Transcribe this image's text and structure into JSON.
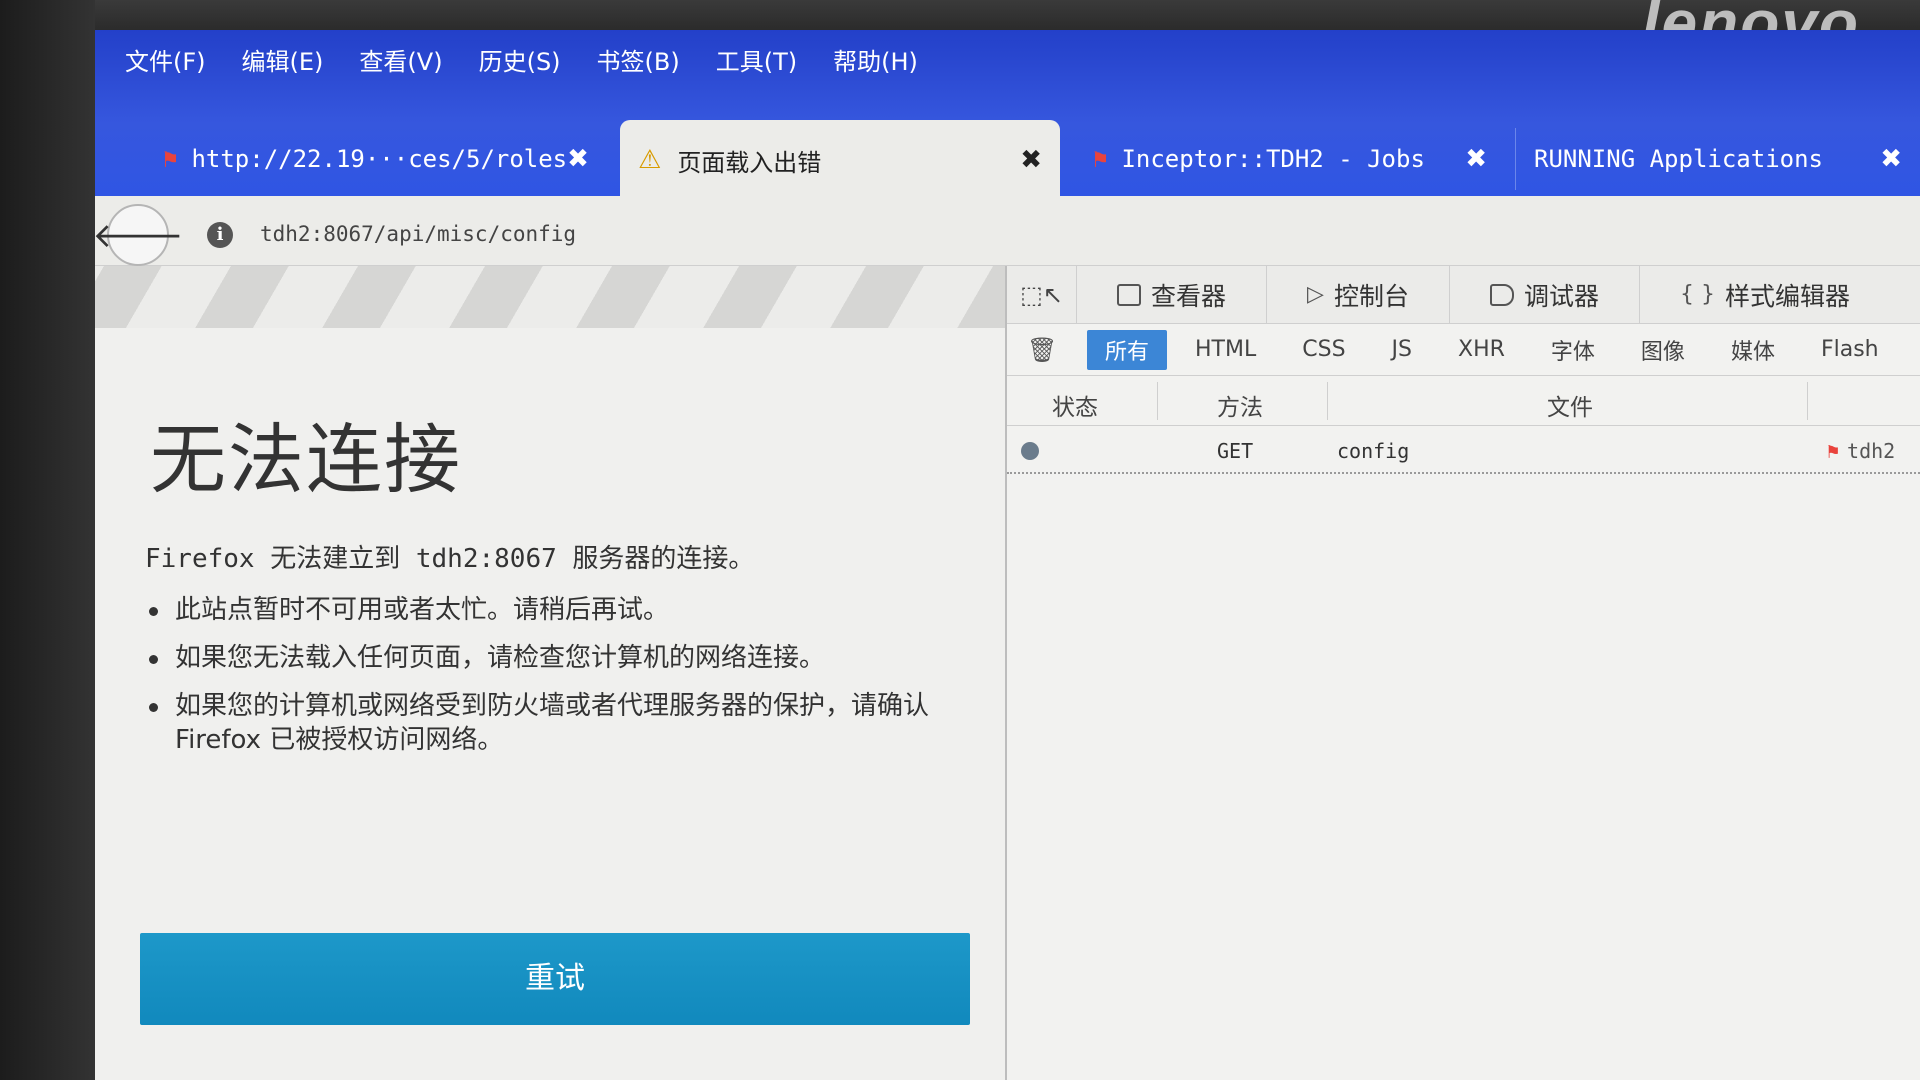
{
  "brand": "lenovo",
  "menubar": [
    "文件(F)",
    "编辑(E)",
    "查看(V)",
    "历史(S)",
    "书签(B)",
    "工具(T)",
    "帮助(H)"
  ],
  "tabs": [
    {
      "title": "http://22.19···ces/5/roles",
      "close": "✖"
    },
    {
      "title": "页面载入出错",
      "close": "✖"
    },
    {
      "title": "Inceptor::TDH2 - Jobs",
      "close": "✖"
    },
    {
      "title": "RUNNING Applications",
      "close": "✖"
    }
  ],
  "navbar": {
    "url": "tdh2:8067/api/misc/config"
  },
  "error": {
    "title": "无法连接",
    "description": "Firefox 无法建立到 tdh2:8067 服务器的连接。",
    "bullets": [
      "此站点暂时不可用或者太忙。请稍后再试。",
      "如果您无法载入任何页面，请检查您计算机的网络连接。",
      "如果您的计算机或网络受到防火墙或者代理服务器的保护，请确认 Firefox 已被授权访问网络。"
    ],
    "retry": "重试"
  },
  "devtools": {
    "tabs": [
      "查看器",
      "控制台",
      "调试器",
      "样式编辑器"
    ],
    "filters": [
      "所有",
      "HTML",
      "CSS",
      "JS",
      "XHR",
      "字体",
      "图像",
      "媒体",
      "Flash"
    ],
    "columns": {
      "status": "状态",
      "method": "方法",
      "file": "文件"
    },
    "rows": [
      {
        "method": "GET",
        "file": "config",
        "domain": "tdh2"
      }
    ]
  }
}
